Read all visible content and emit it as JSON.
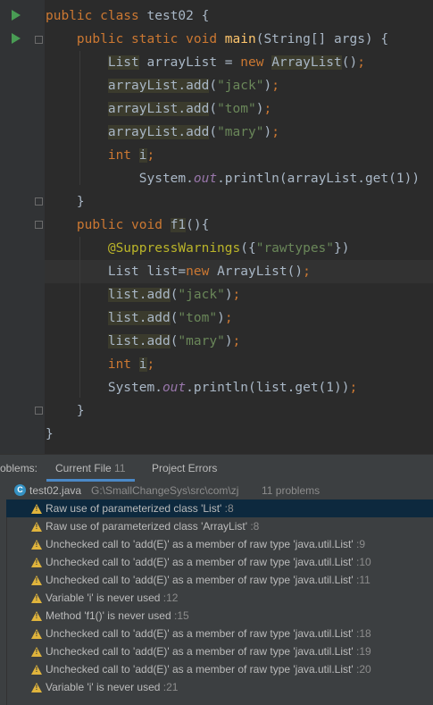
{
  "code": [
    [
      {
        "t": "public class ",
        "c": "kw"
      },
      {
        "t": "test02 {",
        "c": ""
      }
    ],
    [
      {
        "t": "    public static void ",
        "c": "kw"
      },
      {
        "t": "main",
        "c": "fn"
      },
      {
        "t": "(String[] args) {",
        "c": ""
      }
    ],
    [
      {
        "t": "        ",
        "c": ""
      },
      {
        "t": "List",
        "c": "hl"
      },
      {
        "t": " arrayList = ",
        "c": ""
      },
      {
        "t": "new ",
        "c": "kw"
      },
      {
        "t": "ArrayList",
        "c": "hl"
      },
      {
        "t": "()",
        "c": ""
      },
      {
        "t": ";",
        "c": "kw"
      }
    ],
    [
      {
        "t": "        ",
        "c": ""
      },
      {
        "t": "arrayList.add",
        "c": "hl"
      },
      {
        "t": "(",
        "c": ""
      },
      {
        "t": "\"jack\"",
        "c": "str"
      },
      {
        "t": ")",
        "c": ""
      },
      {
        "t": ";",
        "c": "kw"
      }
    ],
    [
      {
        "t": "        ",
        "c": ""
      },
      {
        "t": "arrayList.add",
        "c": "hl"
      },
      {
        "t": "(",
        "c": ""
      },
      {
        "t": "\"tom\"",
        "c": "str"
      },
      {
        "t": ")",
        "c": ""
      },
      {
        "t": ";",
        "c": "kw"
      }
    ],
    [
      {
        "t": "        ",
        "c": ""
      },
      {
        "t": "arrayList.add",
        "c": "hl"
      },
      {
        "t": "(",
        "c": ""
      },
      {
        "t": "\"mary\"",
        "c": "str"
      },
      {
        "t": ")",
        "c": ""
      },
      {
        "t": ";",
        "c": "kw"
      }
    ],
    [
      {
        "t": "        ",
        "c": ""
      },
      {
        "t": "int ",
        "c": "kw"
      },
      {
        "t": "i",
        "c": "hl"
      },
      {
        "t": ";",
        "c": "kw"
      }
    ],
    [
      {
        "t": "            System.",
        "c": ""
      },
      {
        "t": "out",
        "c": "it"
      },
      {
        "t": ".println(arrayList.get(1))",
        "c": ""
      }
    ],
    [
      {
        "t": "    }",
        "c": ""
      }
    ],
    [
      {
        "t": "    public void ",
        "c": "kw"
      },
      {
        "t": "f1",
        "c": "hl"
      },
      {
        "t": "(){",
        "c": ""
      }
    ],
    [
      {
        "t": "        ",
        "c": ""
      },
      {
        "t": "@SuppressWarnings",
        "c": "ann"
      },
      {
        "t": "({",
        "c": ""
      },
      {
        "t": "\"rawtypes\"",
        "c": "str"
      },
      {
        "t": "})",
        "c": ""
      }
    ],
    [
      {
        "t": "        List list=",
        "c": ""
      },
      {
        "t": "new ",
        "c": "kw"
      },
      {
        "t": "ArrayList()",
        "c": ""
      },
      {
        "t": ";",
        "c": "kw"
      }
    ],
    [
      {
        "t": "        ",
        "c": ""
      },
      {
        "t": "list.add",
        "c": "hl"
      },
      {
        "t": "(",
        "c": ""
      },
      {
        "t": "\"jack\"",
        "c": "str"
      },
      {
        "t": ")",
        "c": ""
      },
      {
        "t": ";",
        "c": "kw"
      }
    ],
    [
      {
        "t": "        ",
        "c": ""
      },
      {
        "t": "list.add",
        "c": "hl"
      },
      {
        "t": "(",
        "c": ""
      },
      {
        "t": "\"tom\"",
        "c": "str"
      },
      {
        "t": ")",
        "c": ""
      },
      {
        "t": ";",
        "c": "kw"
      }
    ],
    [
      {
        "t": "        ",
        "c": ""
      },
      {
        "t": "list.add",
        "c": "hl"
      },
      {
        "t": "(",
        "c": ""
      },
      {
        "t": "\"mary\"",
        "c": "str"
      },
      {
        "t": ")",
        "c": ""
      },
      {
        "t": ";",
        "c": "kw"
      }
    ],
    [
      {
        "t": "        ",
        "c": ""
      },
      {
        "t": "int ",
        "c": "kw"
      },
      {
        "t": "i",
        "c": "hl"
      },
      {
        "t": ";",
        "c": "kw"
      }
    ],
    [
      {
        "t": "        System.",
        "c": ""
      },
      {
        "t": "out",
        "c": "it"
      },
      {
        "t": ".println(list.get(1))",
        "c": ""
      },
      {
        "t": ";",
        "c": "kw"
      }
    ],
    [
      {
        "t": "    }",
        "c": ""
      }
    ],
    [
      {
        "t": "}",
        "c": ""
      }
    ]
  ],
  "problems": {
    "tab_label_prefix": "oblems:",
    "tab_current": "Current File",
    "tab_current_count": "11",
    "tab_project": "Project Errors",
    "file_name": "test02.java",
    "file_path": "G:\\SmallChangeSys\\src\\com\\zj",
    "file_count": "11 problems",
    "items": [
      {
        "text": "Raw use of parameterized class 'List'",
        "loc": ":8"
      },
      {
        "text": "Raw use of parameterized class 'ArrayList'",
        "loc": ":8"
      },
      {
        "text": "Unchecked call to 'add(E)' as a member of raw type 'java.util.List'",
        "loc": ":9"
      },
      {
        "text": "Unchecked call to 'add(E)' as a member of raw type 'java.util.List'",
        "loc": ":10"
      },
      {
        "text": "Unchecked call to 'add(E)' as a member of raw type 'java.util.List'",
        "loc": ":11"
      },
      {
        "text": "Variable 'i' is never used",
        "loc": ":12"
      },
      {
        "text": "Method 'f1()' is never used",
        "loc": ":15"
      },
      {
        "text": "Unchecked call to 'add(E)' as a member of raw type 'java.util.List'",
        "loc": ":18"
      },
      {
        "text": "Unchecked call to 'add(E)' as a member of raw type 'java.util.List'",
        "loc": ":19"
      },
      {
        "text": "Unchecked call to 'add(E)' as a member of raw type 'java.util.List'",
        "loc": ":20"
      },
      {
        "text": "Variable 'i' is never used",
        "loc": ":21"
      }
    ]
  }
}
